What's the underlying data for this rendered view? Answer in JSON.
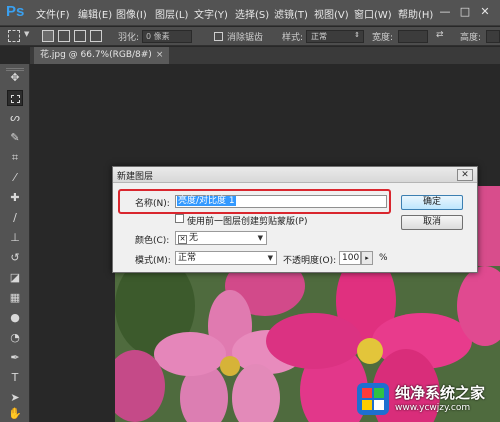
{
  "app": {
    "logo": "Ps"
  },
  "menu": [
    "文件(F)",
    "编辑(E)",
    "图像(I)",
    "图层(L)",
    "文字(Y)",
    "选择(S)",
    "滤镜(T)",
    "视图(V)",
    "窗口(W)",
    "帮助(H)"
  ],
  "window_controls": {
    "minimize": "—",
    "maximize": "□",
    "close": "✕"
  },
  "options_bar": {
    "feather_label": "羽化:",
    "feather_value": "0 像素",
    "antialias_label": "消除锯齿",
    "style_label": "样式:",
    "style_value": "正常",
    "width_label": "宽度:",
    "height_label": "高度:"
  },
  "document_tab": {
    "title": "花.jpg @ 66.7%(RGB/8#)",
    "close": "×"
  },
  "toolbar": {
    "tools": [
      "move-tool",
      "marquee-tool",
      "lasso-tool",
      "quick-select-tool",
      "crop-tool",
      "eyedropper-tool",
      "healing-tool",
      "brush-tool",
      "clone-stamp-tool",
      "history-brush-tool",
      "eraser-tool",
      "gradient-tool",
      "blur-tool",
      "dodge-tool",
      "pen-tool",
      "type-tool",
      "path-select-tool",
      "shape-tool",
      "hand-tool"
    ]
  },
  "dialog": {
    "title": "新建图层",
    "close": "✕",
    "name_label": "名称(N):",
    "name_value": "亮度/对比度 1",
    "clip_label": "使用前一图层创建剪贴蒙版(P)",
    "color_label": "颜色(C):",
    "color_value": "无",
    "mode_label": "模式(M):",
    "mode_value": "正常",
    "opacity_label": "不透明度(O):",
    "opacity_value": "100",
    "opacity_unit": "%",
    "ok_label": "确定",
    "cancel_label": "取消"
  },
  "watermark": {
    "title": "纯净系统之家",
    "url": "www.ycwjzy.com"
  }
}
